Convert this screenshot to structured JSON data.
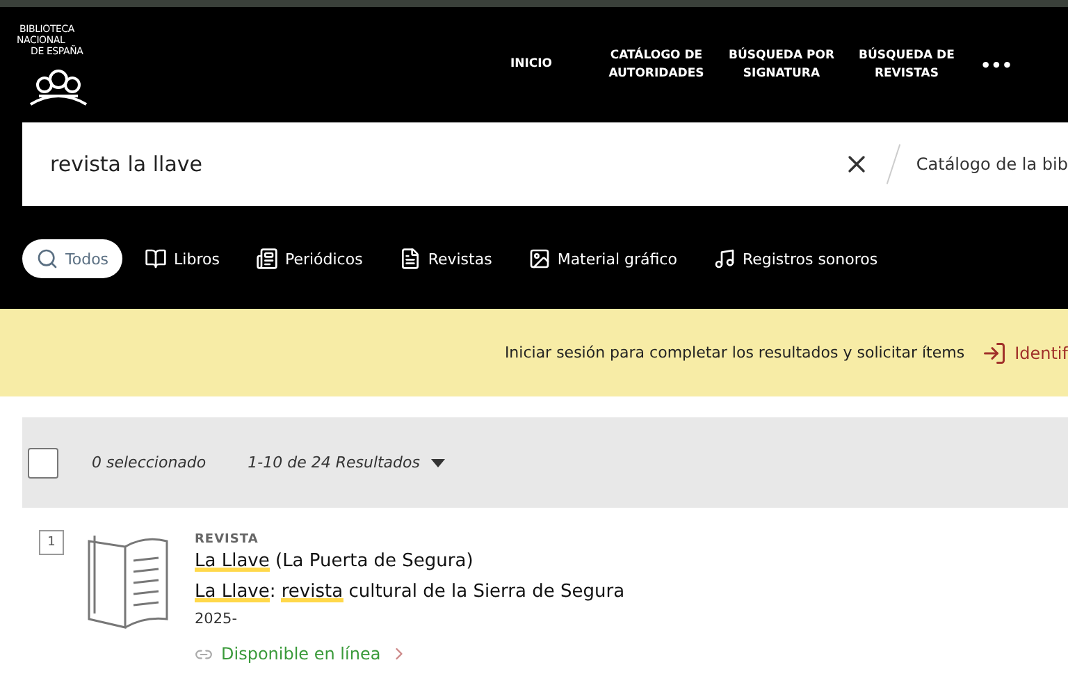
{
  "header": {
    "logo": [
      "BIBLIOTECA",
      "NACIONAL",
      "DE ESPAÑA"
    ],
    "nav": [
      "INICIO",
      "CATÁLOGO DE AUTORIDADES",
      "BÚSQUEDA POR SIGNATURA",
      "BÚSQUEDA DE REVISTAS"
    ],
    "more": "•••"
  },
  "search": {
    "value": "revista la llave",
    "scope": "Catálogo de la bib"
  },
  "tabs": [
    {
      "label": "Todos",
      "kind": "search",
      "selected": true
    },
    {
      "label": "Libros",
      "kind": "book",
      "selected": false
    },
    {
      "label": "Periódicos",
      "kind": "newspaper",
      "selected": false
    },
    {
      "label": "Revistas",
      "kind": "document",
      "selected": false
    },
    {
      "label": "Material gráfico",
      "kind": "image",
      "selected": false
    },
    {
      "label": "Registros sonoros",
      "kind": "music",
      "selected": false
    }
  ],
  "banner": {
    "message": "Iniciar sesión para completar los resultados y solicitar ítems",
    "login": "Identif"
  },
  "toolbar": {
    "checked": false,
    "selected_count": "0 seleccionado",
    "range": "1-10 de 24 Resultados"
  },
  "results": [
    {
      "number": "1",
      "type": "REVISTA",
      "title_lines": [
        [
          {
            "text": "La Llave",
            "highlight": true
          },
          {
            "text": " (La Puerta de Segura)",
            "highlight": false
          }
        ],
        [
          {
            "text": "La Llave",
            "highlight": true
          },
          {
            "text": ": ",
            "highlight": false
          },
          {
            "text": "revista",
            "highlight": true
          },
          {
            "text": " cultural de la Sierra de Segura",
            "highlight": false
          }
        ]
      ],
      "date": "2025-",
      "availability": "Disponible en línea"
    }
  ]
}
